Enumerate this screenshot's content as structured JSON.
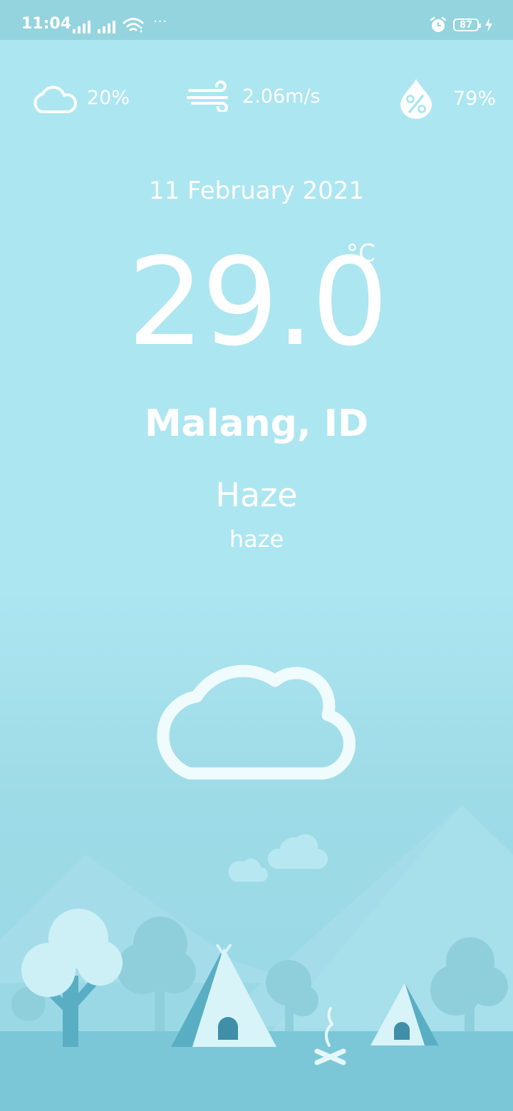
{
  "status_bar": {
    "time": "11:04",
    "more": "···",
    "battery_level": "87"
  },
  "info": {
    "cloudiness": "20%",
    "wind_speed": "2.06m/s",
    "humidity": "79%"
  },
  "weather": {
    "date": "11 February 2021",
    "temperature": "29.0",
    "unit": "°C",
    "location": "Malang, ID",
    "condition": "Haze",
    "description": "haze"
  },
  "icons": {
    "cloudiness": "cloud-icon",
    "wind": "wind-icon",
    "humidity": "humidity-drop-icon",
    "main": "cloud-icon"
  },
  "colors": {
    "background": "#ace6f1",
    "status_bar": "#93d4de",
    "text": "#ffffff"
  }
}
